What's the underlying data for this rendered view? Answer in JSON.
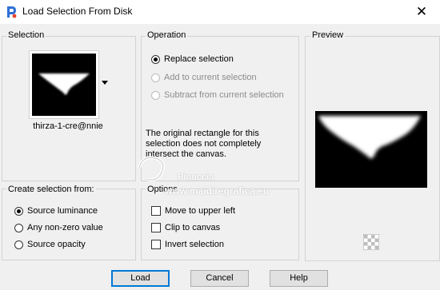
{
  "window": {
    "title": "Load Selection From Disk",
    "close_glyph": "✕"
  },
  "selection": {
    "label": "Selection",
    "file_name": "thirza-1-cre@nnie"
  },
  "operation": {
    "label": "Operation",
    "options": [
      {
        "label": "Replace selection",
        "checked": true,
        "enabled": true
      },
      {
        "label": "Add to current selection",
        "checked": false,
        "enabled": false
      },
      {
        "label": "Subtract from current selection",
        "checked": false,
        "enabled": false
      }
    ],
    "message": "The original rectangle for this selection does not completely intersect the canvas."
  },
  "preview": {
    "label": "Preview"
  },
  "create_from": {
    "label": "Create selection from:",
    "options": [
      {
        "label": "Source luminance",
        "checked": true
      },
      {
        "label": "Any non-zero value",
        "checked": false
      },
      {
        "label": "Source opacity",
        "checked": false
      }
    ]
  },
  "options": {
    "label": "Options",
    "items": [
      {
        "label": "Move to upper left",
        "checked": false
      },
      {
        "label": "Clip to canvas",
        "checked": false
      },
      {
        "label": "Invert selection",
        "checked": false
      }
    ]
  },
  "buttons": {
    "load": "Load",
    "cancel": "Cancel",
    "help": "Help"
  },
  "watermark": {
    "name": "Pinuccia",
    "url": "www.maidiregrafica.eu"
  },
  "colors": {
    "accent": "#0078d7",
    "group_border": "#d2d2d2",
    "background": "#f0f0f0"
  }
}
